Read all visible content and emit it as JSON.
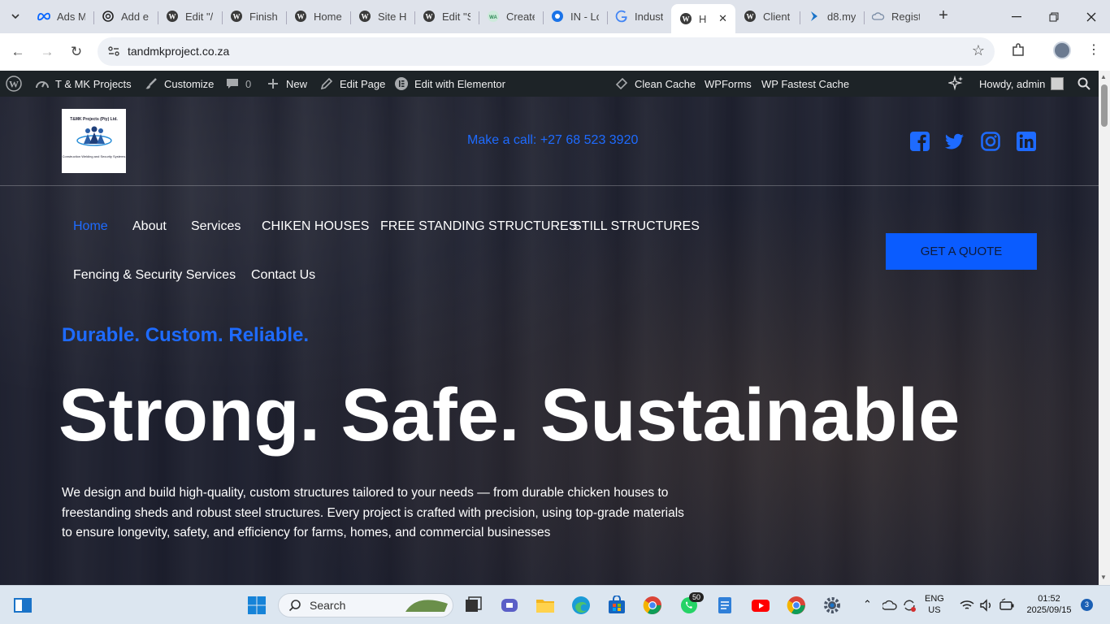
{
  "browser": {
    "tabs": [
      {
        "label": "Ads M",
        "icon": "meta-icon"
      },
      {
        "label": "Add e",
        "icon": "openai-icon"
      },
      {
        "label": "Edit \"/",
        "icon": "wordpress-icon"
      },
      {
        "label": "Finish",
        "icon": "wordpress-icon"
      },
      {
        "label": "Home",
        "icon": "wordpress-icon"
      },
      {
        "label": "Site H",
        "icon": "wordpress-icon"
      },
      {
        "label": "Edit \"S",
        "icon": "wordpress-icon"
      },
      {
        "label": "Create",
        "icon": "wa-icon"
      },
      {
        "label": "IN - Lo",
        "icon": "edge-icon"
      },
      {
        "label": "Indust",
        "icon": "google-icon"
      },
      {
        "label": "H",
        "icon": "wordpress-icon",
        "active": true
      },
      {
        "label": "Client",
        "icon": "wordpress-icon"
      },
      {
        "label": "d8.my",
        "icon": "arrow-icon"
      },
      {
        "label": "Regist",
        "icon": "cloud-icon"
      }
    ],
    "url": "tandmkproject.co.za"
  },
  "adminbar": {
    "site_name": "T & MK Projects",
    "customize": "Customize",
    "comments_count": "0",
    "new": "New",
    "edit_page": "Edit Page",
    "edit_elementor": "Edit with Elementor",
    "clean_cache": "Clean Cache",
    "wpforms": "WPForms",
    "fastest_cache": "WP Fastest Cache",
    "howdy": "Howdy, admin"
  },
  "site": {
    "logo": {
      "title": "T&MK Projects (Pty) Ltd.",
      "subtitle": "Construction Welding and Security Systems"
    },
    "call": "Make a call: +27 68 523 3920",
    "nav": [
      "Home",
      "About",
      "Services",
      "CHIKEN HOUSES",
      "FREE STANDING STRUCTURES",
      "STILL STRUCTURES",
      "Fencing & Security Services",
      "Contact Us"
    ],
    "quote_button": "GET A QUOTE",
    "tagline": "Durable. Custom. Reliable.",
    "headline": "Strong. Safe. Sustainable",
    "description": "We design and build high-quality, custom structures tailored to your needs — from durable chicken houses to freestanding sheds and robust steel structures. Every project is crafted with precision, using top-grade materials to ensure longevity, safety, and efficiency for farms, homes, and commercial businesses"
  },
  "taskbar": {
    "search_label": "Search",
    "whatsapp_badge": "50",
    "language": "ENG",
    "region": "US",
    "time": "01:52",
    "date": "2025/09/15",
    "notifications": "3"
  },
  "colors": {
    "accent_blue": "#1e6bff",
    "button_blue": "#0a5cff",
    "admin_bar": "#1d2327"
  }
}
